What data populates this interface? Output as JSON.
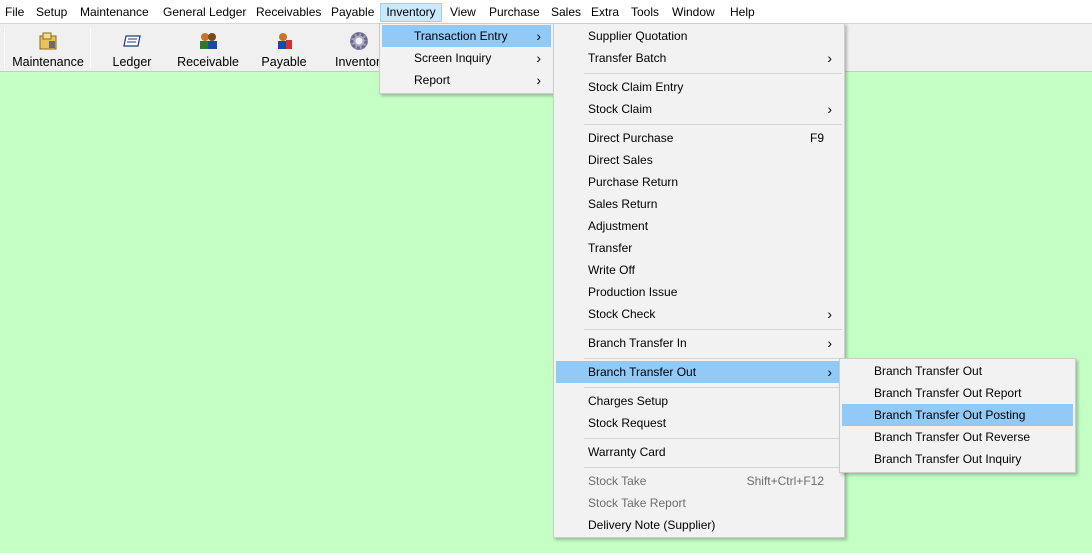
{
  "menubar": {
    "items": [
      "File",
      "Setup",
      "Maintenance",
      "General Ledger",
      "Receivables",
      "Payable",
      "Inventory",
      "View",
      "Purchase",
      "Sales",
      "Extra",
      "Tools",
      "Window",
      "Help"
    ]
  },
  "toolbar": {
    "buttons": [
      {
        "label": "Maintenance",
        "icon": "maintenance-icon"
      },
      {
        "label": "Ledger",
        "icon": "ledger-icon"
      },
      {
        "label": "Receivable",
        "icon": "receivable-icon"
      },
      {
        "label": "Payable",
        "icon": "payable-icon"
      },
      {
        "label": "Inventor",
        "icon": "gear-icon"
      }
    ]
  },
  "inventory_menu": {
    "items": [
      {
        "label": "Transaction Entry",
        "submenu": true,
        "highlighted": true
      },
      {
        "label": "Screen Inquiry",
        "submenu": true
      },
      {
        "label": "Report",
        "submenu": true
      }
    ]
  },
  "transaction_menu": {
    "items": [
      {
        "label": "Supplier Quotation"
      },
      {
        "label": "Transfer Batch",
        "submenu": true
      },
      {
        "label": "Stock Claim Entry"
      },
      {
        "label": "Stock Claim",
        "submenu": true
      },
      {
        "label": "Direct Purchase",
        "shortcut": "F9"
      },
      {
        "label": "Direct Sales"
      },
      {
        "label": "Purchase Return"
      },
      {
        "label": "Sales Return"
      },
      {
        "label": "Adjustment"
      },
      {
        "label": "Transfer"
      },
      {
        "label": "Write Off"
      },
      {
        "label": "Production Issue"
      },
      {
        "label": "Stock Check",
        "submenu": true
      },
      {
        "label": "Branch Transfer In",
        "submenu": true
      },
      {
        "label": "Branch Transfer Out",
        "submenu": true,
        "highlighted": true
      },
      {
        "label": "Charges Setup"
      },
      {
        "label": "Stock Request"
      },
      {
        "label": "Warranty Card"
      },
      {
        "label": "Stock Take",
        "shortcut": "Shift+Ctrl+F12",
        "disabled": true
      },
      {
        "label": "Stock Take Report",
        "disabled": true
      },
      {
        "label": "Delivery Note (Supplier)"
      }
    ]
  },
  "branch_out_menu": {
    "items": [
      {
        "label": "Branch Transfer Out"
      },
      {
        "label": "Branch Transfer Out Report"
      },
      {
        "label": "Branch Transfer Out Posting",
        "highlighted": true
      },
      {
        "label": "Branch Transfer Out Reverse"
      },
      {
        "label": "Branch Transfer Out Inquiry"
      }
    ]
  },
  "colors": {
    "workspace": "#c4ffc4",
    "highlight": "#91c9f7",
    "menu_bg": "#f2f2f2"
  },
  "icons": {
    "submenu_arrow": "chevron-right-icon"
  }
}
